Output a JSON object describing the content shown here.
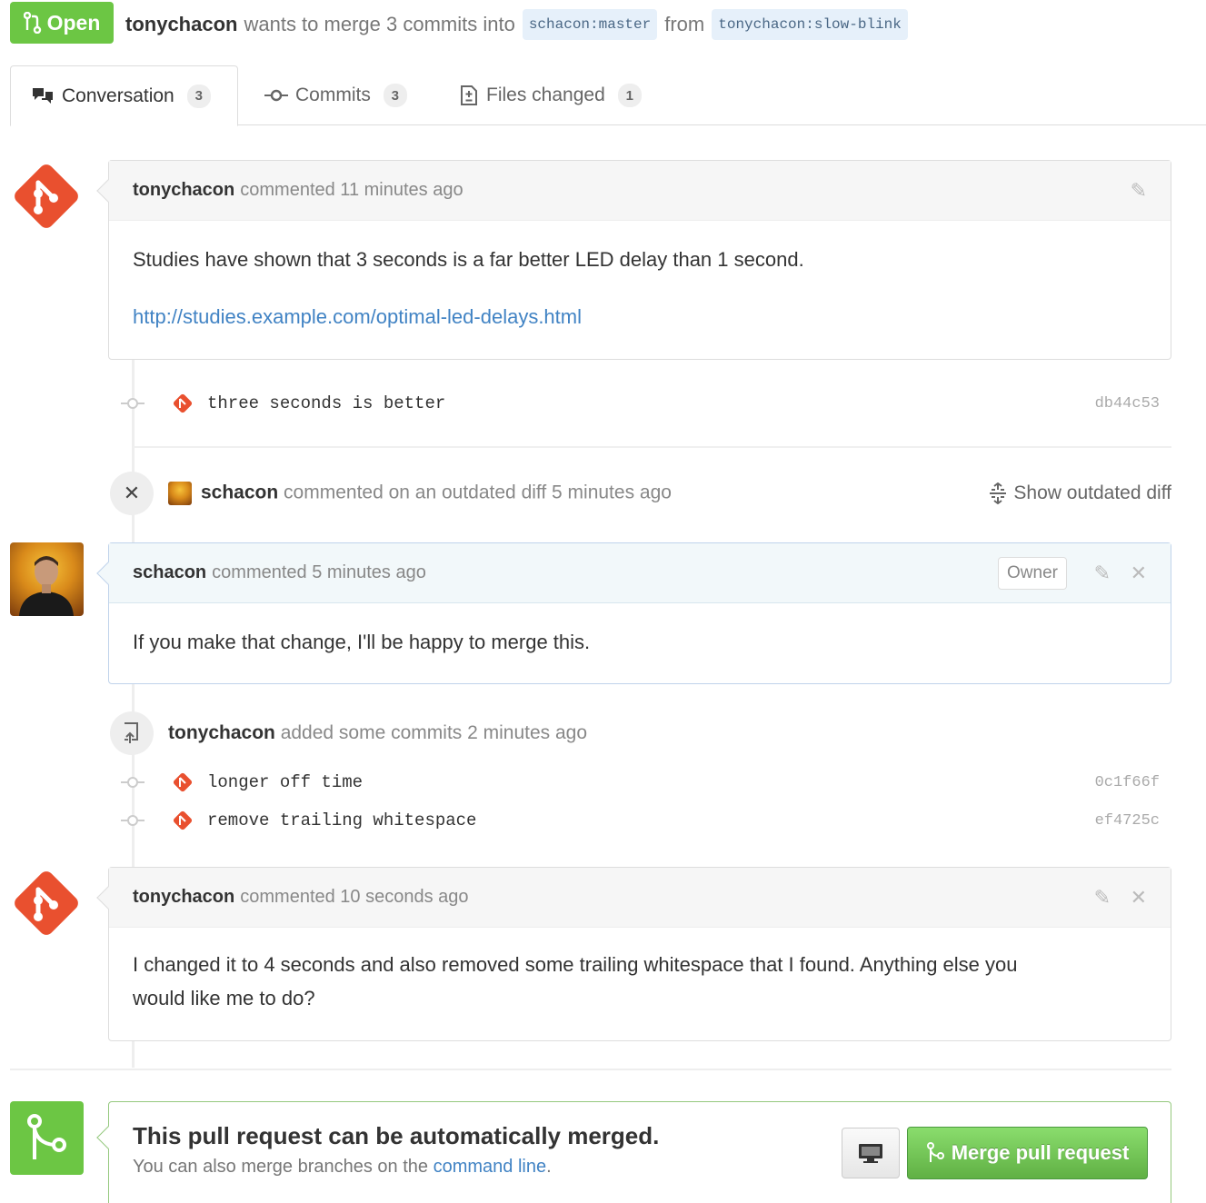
{
  "header": {
    "state": "Open",
    "author": "tonychacon",
    "summary": "wants to merge 3 commits into",
    "base_branch": "schacon:master",
    "from_word": "from",
    "head_branch": "tonychacon:slow-blink"
  },
  "tabs": [
    {
      "label": "Conversation",
      "count": "3",
      "icon": "comment-discussion-icon"
    },
    {
      "label": "Commits",
      "count": "3",
      "icon": "git-commit-icon"
    },
    {
      "label": "Files changed",
      "count": "1",
      "icon": "diff-icon"
    }
  ],
  "comments": [
    {
      "author": "tonychacon",
      "meta": "commented 11 minutes ago",
      "body": "Studies have shown that 3 seconds is a far better LED delay than 1 second.",
      "link": "http://studies.example.com/optimal-led-delays.html"
    },
    {
      "author": "schacon",
      "meta": "commented 5 minutes ago",
      "badge": "Owner",
      "body": "If you make that change, I'll be happy to merge this."
    },
    {
      "author": "tonychacon",
      "meta": "commented 10 seconds ago",
      "body_line1": "I changed it to 4 seconds and also removed some trailing whitespace that I found. Anything else you",
      "body_line2": "would like me to do?"
    }
  ],
  "commits": [
    {
      "message": "three seconds is better",
      "sha": "db44c53"
    },
    {
      "message": "longer off time",
      "sha": "0c1f66f"
    },
    {
      "message": "remove trailing whitespace",
      "sha": "ef4725c"
    }
  ],
  "events": {
    "outdated": {
      "author": "schacon",
      "text": "commented on an outdated diff 5 minutes ago",
      "action": "Show outdated diff"
    },
    "added_commits": {
      "author": "tonychacon",
      "text": "added some commits 2 minutes ago"
    }
  },
  "merge": {
    "title": "This pull request can be automatically merged.",
    "sub_prefix": "You can also merge branches on the",
    "sub_link": "command line",
    "sub_suffix": ".",
    "button": "Merge pull request"
  },
  "colors": {
    "open_green": "#6cc644",
    "git_orange": "#e9502f",
    "link_blue": "#4183c4"
  }
}
